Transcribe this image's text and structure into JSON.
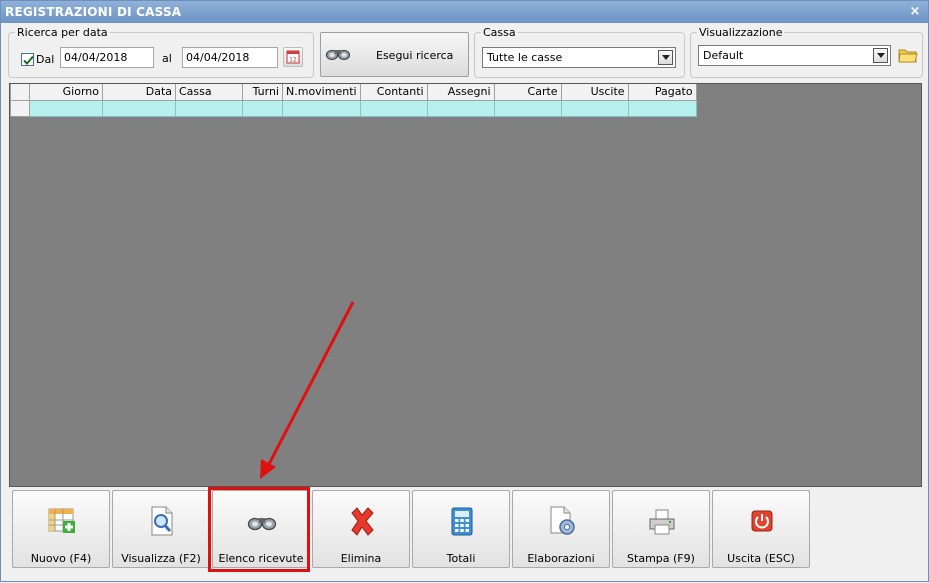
{
  "window": {
    "title": "REGISTRAZIONI DI CASSA",
    "close_glyph": "×"
  },
  "search_date": {
    "legend": "Ricerca per data",
    "dal_checked": true,
    "dal_label": "Dal",
    "from_value": "04/04/2018",
    "al_label": "al",
    "to_value": "04/04/2018"
  },
  "search_button": {
    "label": "Esegui ricerca",
    "icon": "binoculars-icon"
  },
  "cassa": {
    "legend": "Cassa",
    "selected": "Tutte le casse"
  },
  "visualizzazione": {
    "legend": "Visualizzazione",
    "selected": "Default"
  },
  "grid": {
    "columns": [
      "Giorno",
      "Data",
      "Cassa",
      "Turni",
      "N.movimenti",
      "Contanti",
      "Assegni",
      "Carte",
      "Uscite",
      "Pagato"
    ]
  },
  "toolbar": {
    "buttons": [
      {
        "label": "Nuovo (F4)",
        "icon": "grid-add-icon"
      },
      {
        "label": "Visualizza (F2)",
        "icon": "document-magnifier-icon"
      },
      {
        "label": "Elenco ricevute",
        "icon": "binoculars-icon"
      },
      {
        "label": "Elimina",
        "icon": "red-x-icon"
      },
      {
        "label": "Totali",
        "icon": "calculator-icon"
      },
      {
        "label": "Elaborazioni",
        "icon": "document-gear-icon"
      },
      {
        "label": "Stampa (F9)",
        "icon": "printer-icon"
      },
      {
        "label": "Uscita (ESC)",
        "icon": "power-icon"
      }
    ]
  },
  "colors": {
    "title_bar": "#7a9dcc",
    "grid_background": "#808080",
    "row_highlight": "#b6f0ee",
    "annotation_red": "#e01010"
  }
}
